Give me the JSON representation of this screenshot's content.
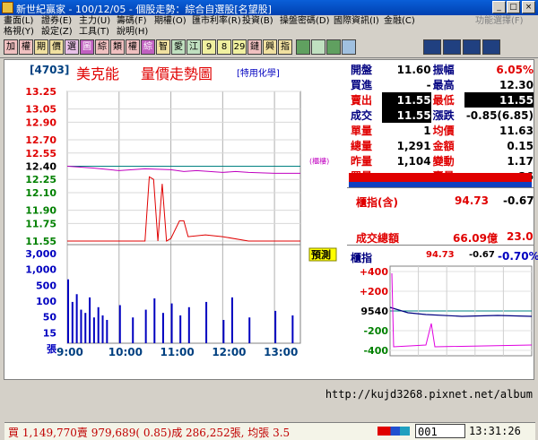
{
  "window": {
    "title": "新世紀贏家 - 100/12/05 - 個股走勢：綜合自選股[名望股]",
    "controls": [
      "_",
      "□",
      "×"
    ]
  },
  "menu_row1": [
    "畫面(L)",
    "證券(E)",
    "主力(U)",
    "籌碼(F)",
    "期權(O)",
    "匯市利率(R)",
    "投資(B)",
    "操盤密碼(D)",
    "國際資訊(I)",
    "金融(C)",
    "功能選擇(F)"
  ],
  "menu_row2": [
    "格視(Y)",
    "設定(Z)",
    "工具(T)",
    "說明(H)"
  ],
  "toolbar": [
    "加",
    "權",
    "期",
    "價",
    "選",
    "圖",
    "綜",
    "類",
    "權",
    "綜",
    "智",
    "愛",
    "江",
    "9",
    "8",
    "29",
    "鏈",
    "興",
    "指"
  ],
  "toolbar_icons": [
    "grid-icon",
    "window-icon",
    "grid-icon",
    "settings-icon",
    "esc-key-icon",
    "page-up-icon",
    "page-down-icon",
    "window-icon"
  ],
  "stock": {
    "code": "[4703]",
    "name": "美克能",
    "chart_title": "量價走勢圖",
    "industry": "[特用化學]"
  },
  "quote": {
    "rows": [
      {
        "l1": "開盤",
        "v1": "11.60",
        "l2": "振幅",
        "v2": "6.05%"
      },
      {
        "l1": "買進",
        "v1": "-",
        "l2": "最高",
        "v2": "12.30"
      },
      {
        "l1": "賣出",
        "v1": "11.55",
        "l2": "最低",
        "v2": "11.55"
      },
      {
        "l1": "成交",
        "v1": "11.55",
        "l2": "漲跌",
        "v2": "-0.85(6.85)"
      },
      {
        "l1": "單量",
        "v1": "1",
        "l2": "均價",
        "v2": "11.63"
      },
      {
        "l1": "總量",
        "v1": "1,291",
        "l2": "金額",
        "v2": "0.15"
      },
      {
        "l1": "昨量",
        "v1": "1,104",
        "l2": "變動",
        "v2": "1.17"
      },
      {
        "l1": "買量",
        "v1": "-",
        "l2": "賣量",
        "v2": "36"
      }
    ]
  },
  "index_panel": {
    "label": "櫃指(含)",
    "value": "94.73",
    "change": "-0.67",
    "volume_label": "成交總額",
    "volume": "66.09億",
    "volume2": "23.0",
    "mini_label": "櫃指",
    "mini_value": "94.73",
    "mini_change": "-0.67",
    "mini_pct": "-0.70%",
    "mini_ticks": [
      "+400",
      "+200",
      "9540",
      "-200",
      "-400"
    ]
  },
  "status": {
    "text": "買 1,149,770賣 979,689( 0.85)成 286,252張, 均張 3.5",
    "field": "001",
    "clock": "13:31:26"
  },
  "url": "http://kujd3268.pixnet.net/album",
  "chart_data": {
    "type": "line",
    "price_axis": {
      "ticks": [
        13.25,
        13.05,
        12.9,
        12.7,
        12.55,
        12.4,
        12.25,
        12.1,
        11.9,
        11.75,
        11.55
      ],
      "ylim": [
        11.55,
        13.25
      ]
    },
    "x_ticks": [
      "9:00",
      "10:00",
      "11:00",
      "12:00",
      "13:00"
    ],
    "reference_price": 12.4,
    "reference_label": "(櫃樓)",
    "volume_axis": {
      "ticks": [
        "3,000",
        "1,000",
        "500",
        "100",
        "50",
        "15",
        "張"
      ]
    },
    "volume_label": "預測",
    "series": [
      {
        "x": [
          "9:00",
          "9:30",
          "10:00",
          "10:30",
          "10:35",
          "10:40",
          "10:45",
          "10:50",
          "10:55",
          "11:00",
          "11:10",
          "11:15",
          "11:20",
          "11:40",
          "12:00",
          "12:30",
          "13:00",
          "13:30"
        ],
        "values": [
          11.55,
          11.55,
          11.55,
          11.55,
          12.28,
          12.25,
          11.55,
          12.2,
          11.55,
          11.58,
          11.78,
          11.78,
          11.6,
          11.62,
          11.6,
          11.55,
          11.55,
          11.55
        ]
      }
    ],
    "volume": [
      {
        "x": "9:00",
        "v": 300
      },
      {
        "x": "9:05",
        "v": 40
      },
      {
        "x": "9:10",
        "v": 80
      },
      {
        "x": "9:15",
        "v": 20
      },
      {
        "x": "9:20",
        "v": 15
      },
      {
        "x": "9:25",
        "v": 60
      },
      {
        "x": "9:30",
        "v": 10
      },
      {
        "x": "9:35",
        "v": 25
      },
      {
        "x": "9:40",
        "v": 12
      },
      {
        "x": "9:45",
        "v": 8
      },
      {
        "x": "10:00",
        "v": 30
      },
      {
        "x": "10:15",
        "v": 10
      },
      {
        "x": "10:30",
        "v": 20
      },
      {
        "x": "10:40",
        "v": 55
      },
      {
        "x": "10:50",
        "v": 15
      },
      {
        "x": "11:00",
        "v": 35
      },
      {
        "x": "11:10",
        "v": 12
      },
      {
        "x": "11:20",
        "v": 25
      },
      {
        "x": "11:40",
        "v": 40
      },
      {
        "x": "12:00",
        "v": 8
      },
      {
        "x": "12:10",
        "v": 60
      },
      {
        "x": "12:30",
        "v": 10
      },
      {
        "x": "13:00",
        "v": 18
      },
      {
        "x": "13:20",
        "v": 12
      }
    ]
  }
}
